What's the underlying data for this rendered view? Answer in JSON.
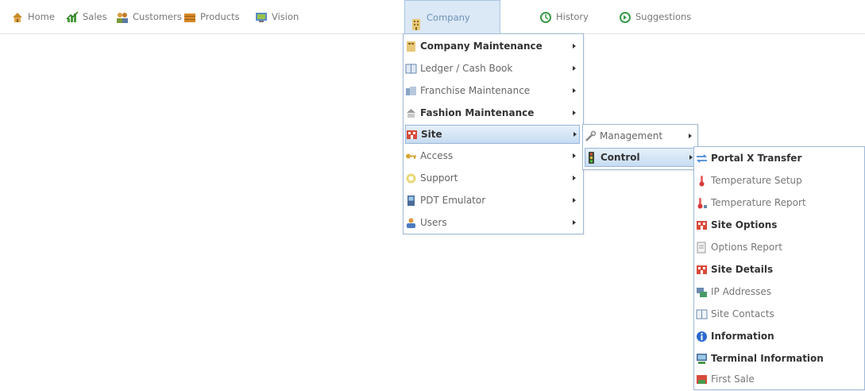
{
  "nav": {
    "items": [
      {
        "label": "Home",
        "icon": "home-icon"
      },
      {
        "label": "Sales",
        "icon": "sales-chart-icon"
      },
      {
        "label": "Customers",
        "icon": "customers-icon"
      },
      {
        "label": "Products",
        "icon": "products-icon"
      },
      {
        "label": "Vision",
        "icon": "vision-icon"
      },
      {
        "label": "Company",
        "icon": "company-icon",
        "active": true
      },
      {
        "label": "History",
        "icon": "history-icon"
      },
      {
        "label": "Suggestions",
        "icon": "suggestions-icon"
      }
    ]
  },
  "company_menu": {
    "items": [
      {
        "label": "Company Maintenance",
        "bold": true,
        "icon": "company-maintenance-icon"
      },
      {
        "label": "Ledger / Cash Book",
        "icon": "ledger-icon"
      },
      {
        "label": "Franchise Maintenance",
        "icon": "franchise-icon"
      },
      {
        "label": "Fashion Maintenance",
        "bold": true,
        "icon": "fashion-icon"
      },
      {
        "label": "Site",
        "bold": true,
        "selected": true,
        "icon": "site-icon"
      },
      {
        "label": "Access",
        "icon": "key-icon"
      },
      {
        "label": "Support",
        "icon": "support-icon"
      },
      {
        "label": "PDT Emulator",
        "icon": "pdt-icon"
      },
      {
        "label": "Users",
        "icon": "users-icon"
      }
    ]
  },
  "site_menu": {
    "items": [
      {
        "label": "Management",
        "icon": "wrench-icon"
      },
      {
        "label": "Control",
        "bold": true,
        "selected": true,
        "icon": "traffic-light-icon"
      }
    ]
  },
  "control_menu": {
    "items": [
      {
        "label": "Portal X Transfer",
        "bold": true,
        "icon": "transfer-arrows-icon"
      },
      {
        "label": "Temperature Setup",
        "icon": "thermometer-icon"
      },
      {
        "label": "Temperature Report",
        "icon": "thermometer-report-icon"
      },
      {
        "label": "Site Options",
        "bold": true,
        "icon": "site-options-icon"
      },
      {
        "label": "Options Report",
        "icon": "report-icon"
      },
      {
        "label": "Site Details",
        "bold": true,
        "icon": "site-details-icon"
      },
      {
        "label": "IP Addresses",
        "icon": "network-icon"
      },
      {
        "label": "Site Contacts",
        "icon": "contacts-book-icon"
      },
      {
        "label": "Information",
        "bold": true,
        "icon": "info-icon"
      },
      {
        "label": "Terminal Information",
        "bold": true,
        "icon": "terminal-icon"
      },
      {
        "label": "First Sale",
        "icon": "first-sale-icon"
      }
    ]
  },
  "colors": {
    "accent": "#dbe8f6",
    "menu_border": "#9fb9d6",
    "selected": "#c7dcf2"
  }
}
